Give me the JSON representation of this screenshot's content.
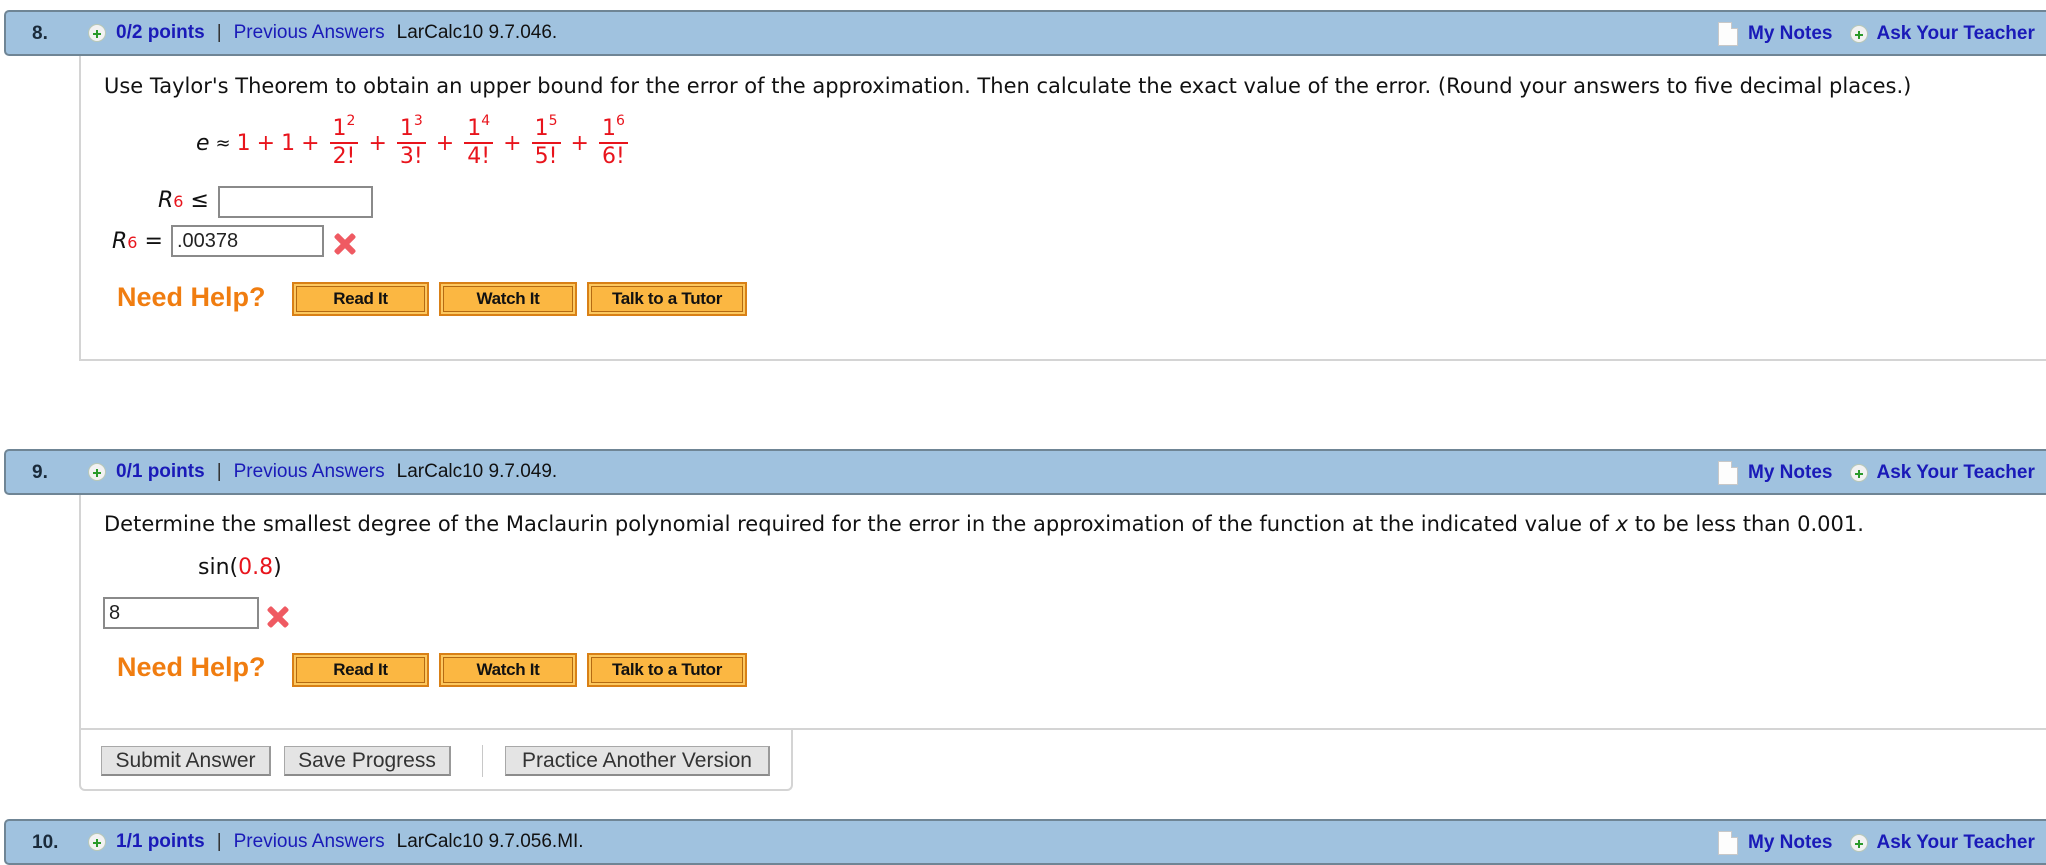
{
  "questions": [
    {
      "number": "8.",
      "points": "0/2 points",
      "separator": "|",
      "previous_answers": "Previous Answers",
      "code": "LarCalc10 9.7.046.",
      "my_notes": "My Notes",
      "ask_teacher": "Ask Your Teacher",
      "prompt": "Use Taylor's Theorem to obtain an upper bound for the error of the approximation. Then calculate the exact value of the error. (Round your answers to five decimal places.)",
      "formula": {
        "lhs": "e",
        "approx": "≈",
        "terms": [
          "1",
          "1"
        ],
        "fractions": [
          {
            "num": "1",
            "exp": "2",
            "den": "2!"
          },
          {
            "num": "1",
            "exp": "3",
            "den": "3!"
          },
          {
            "num": "1",
            "exp": "4",
            "den": "4!"
          },
          {
            "num": "1",
            "exp": "5",
            "den": "5!"
          },
          {
            "num": "1",
            "exp": "6",
            "den": "6!"
          }
        ],
        "plus": "+"
      },
      "answers": [
        {
          "label": "R",
          "subscript": "6",
          "relation": "≤",
          "value": ""
        },
        {
          "label": "R",
          "subscript": "6",
          "relation": "=",
          "value": ".00378",
          "status": "incorrect"
        }
      ],
      "need_help": "Need Help?",
      "help_buttons": [
        "Read It",
        "Watch It",
        "Talk to a Tutor"
      ]
    },
    {
      "number": "9.",
      "points": "0/1 points",
      "separator": "|",
      "previous_answers": "Previous Answers",
      "code": "LarCalc10 9.7.049.",
      "my_notes": "My Notes",
      "ask_teacher": "Ask Your Teacher",
      "prompt_before_x": "Determine the smallest degree of the Maclaurin polynomial required for the error in the approximation of the function at the indicated value of ",
      "prompt_var": "x",
      "prompt_after_x": " to be less than 0.001.",
      "function": {
        "name": "sin(",
        "arg": "0.8",
        "close": ")"
      },
      "answer": {
        "value": "8",
        "status": "incorrect"
      },
      "need_help": "Need Help?",
      "help_buttons": [
        "Read It",
        "Watch It",
        "Talk to a Tutor"
      ],
      "actions": [
        "Submit Answer",
        "Save Progress",
        "Practice Another Version"
      ]
    },
    {
      "number": "10.",
      "points": "1/1 points",
      "separator": "|",
      "previous_answers": "Previous Answers",
      "code": "LarCalc10 9.7.056.MI.",
      "my_notes": "My Notes",
      "ask_teacher": "Ask Your Teacher"
    }
  ]
}
